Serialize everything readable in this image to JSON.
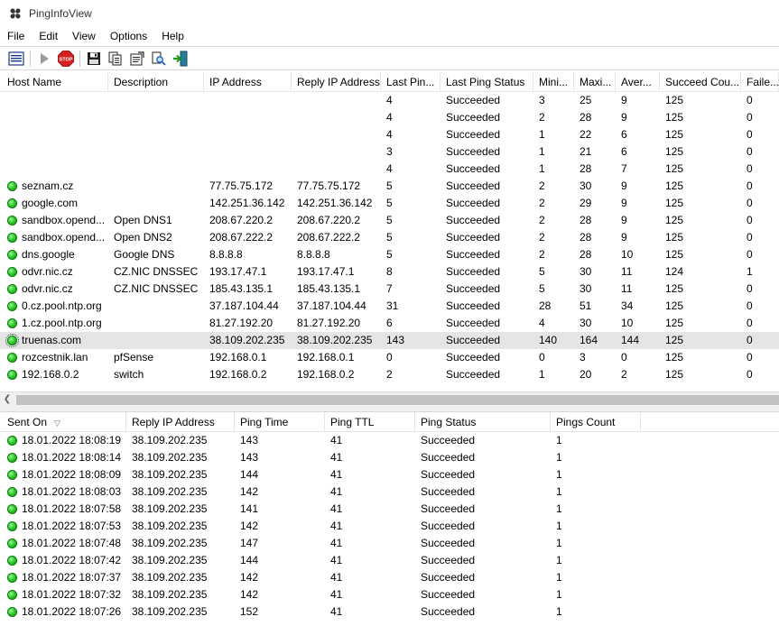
{
  "window": {
    "title": "PingInfoView",
    "icon": "ping-app-icon"
  },
  "menu": [
    "File",
    "Edit",
    "View",
    "Options",
    "Help"
  ],
  "toolbar": {
    "buttons": [
      {
        "name": "properties-list-button",
        "icon": "list-icon"
      },
      {
        "name": "start-ping-button",
        "icon": "play-icon"
      },
      {
        "name": "stop-ping-button",
        "icon": "stop-icon",
        "label": "STOP"
      },
      {
        "name": "save-button",
        "icon": "floppy-icon"
      },
      {
        "name": "copy-button",
        "icon": "copy-icon"
      },
      {
        "name": "properties-button",
        "icon": "properties-icon"
      },
      {
        "name": "find-button",
        "icon": "find-icon"
      },
      {
        "name": "exit-button",
        "icon": "exit-icon"
      }
    ]
  },
  "hosts": {
    "columns": [
      "Host Name",
      "Description",
      "IP Address",
      "Reply IP Address",
      "Last Pin...",
      "Last Ping Status",
      "Mini...",
      "Maxi...",
      "Aver...",
      "Succeed Cou...",
      "Faile..."
    ],
    "rows": [
      [
        "",
        "",
        "",
        "",
        "4",
        "Succeeded",
        "3",
        "25",
        "9",
        "125",
        "0"
      ],
      [
        "",
        "",
        "",
        "",
        "4",
        "Succeeded",
        "2",
        "28",
        "9",
        "125",
        "0"
      ],
      [
        "",
        "",
        "",
        "",
        "4",
        "Succeeded",
        "1",
        "22",
        "6",
        "125",
        "0"
      ],
      [
        "",
        "",
        "",
        "",
        "3",
        "Succeeded",
        "1",
        "21",
        "6",
        "125",
        "0"
      ],
      [
        "",
        "",
        "",
        "",
        "4",
        "Succeeded",
        "1",
        "28",
        "7",
        "125",
        "0"
      ],
      [
        "seznam.cz",
        "",
        "77.75.75.172",
        "77.75.75.172",
        "5",
        "Succeeded",
        "2",
        "30",
        "9",
        "125",
        "0"
      ],
      [
        "google.com",
        "",
        "142.251.36.142",
        "142.251.36.142",
        "5",
        "Succeeded",
        "2",
        "29",
        "9",
        "125",
        "0"
      ],
      [
        "sandbox.opend...",
        "Open DNS1",
        "208.67.220.2",
        "208.67.220.2",
        "5",
        "Succeeded",
        "2",
        "28",
        "9",
        "125",
        "0"
      ],
      [
        "sandbox.opend...",
        "Open DNS2",
        "208.67.222.2",
        "208.67.222.2",
        "5",
        "Succeeded",
        "2",
        "28",
        "9",
        "125",
        "0"
      ],
      [
        "dns.google",
        "Google DNS",
        "8.8.8.8",
        "8.8.8.8",
        "5",
        "Succeeded",
        "2",
        "28",
        "10",
        "125",
        "0"
      ],
      [
        "odvr.nic.cz",
        "CZ.NIC DNSSEC",
        "193.17.47.1",
        "193.17.47.1",
        "8",
        "Succeeded",
        "5",
        "30",
        "11",
        "124",
        "1"
      ],
      [
        "odvr.nic.cz",
        "CZ.NIC DNSSEC",
        "185.43.135.1",
        "185.43.135.1",
        "7",
        "Succeeded",
        "5",
        "30",
        "11",
        "125",
        "0"
      ],
      [
        "0.cz.pool.ntp.org",
        "",
        "37.187.104.44",
        "37.187.104.44",
        "31",
        "Succeeded",
        "28",
        "51",
        "34",
        "125",
        "0"
      ],
      [
        "1.cz.pool.ntp.org",
        "",
        "81.27.192.20",
        "81.27.192.20",
        "6",
        "Succeeded",
        "4",
        "30",
        "10",
        "125",
        "0"
      ],
      [
        "truenas.com",
        "",
        "38.109.202.235",
        "38.109.202.235",
        "143",
        "Succeeded",
        "140",
        "164",
        "144",
        "125",
        "0"
      ],
      [
        "rozcestnik.lan",
        "pfSense",
        "192.168.0.1",
        "192.168.0.1",
        "0",
        "Succeeded",
        "0",
        "3",
        "0",
        "125",
        "0"
      ],
      [
        "192.168.0.2",
        "switch",
        "192.168.0.2",
        "192.168.0.2",
        "2",
        "Succeeded",
        "1",
        "20",
        "2",
        "125",
        "0"
      ]
    ],
    "selected_index": 14
  },
  "history": {
    "columns": [
      "Sent On",
      "Reply IP Address",
      "Ping Time",
      "Ping TTL",
      "Ping Status",
      "Pings Count"
    ],
    "rows": [
      [
        "18.01.2022 18:08:19",
        "38.109.202.235",
        "143",
        "41",
        "Succeeded",
        "1"
      ],
      [
        "18.01.2022 18:08:14",
        "38.109.202.235",
        "143",
        "41",
        "Succeeded",
        "1"
      ],
      [
        "18.01.2022 18:08:09",
        "38.109.202.235",
        "144",
        "41",
        "Succeeded",
        "1"
      ],
      [
        "18.01.2022 18:08:03",
        "38.109.202.235",
        "142",
        "41",
        "Succeeded",
        "1"
      ],
      [
        "18.01.2022 18:07:58",
        "38.109.202.235",
        "141",
        "41",
        "Succeeded",
        "1"
      ],
      [
        "18.01.2022 18:07:53",
        "38.109.202.235",
        "142",
        "41",
        "Succeeded",
        "1"
      ],
      [
        "18.01.2022 18:07:48",
        "38.109.202.235",
        "147",
        "41",
        "Succeeded",
        "1"
      ],
      [
        "18.01.2022 18:07:42",
        "38.109.202.235",
        "144",
        "41",
        "Succeeded",
        "1"
      ],
      [
        "18.01.2022 18:07:37",
        "38.109.202.235",
        "142",
        "41",
        "Succeeded",
        "1"
      ],
      [
        "18.01.2022 18:07:32",
        "38.109.202.235",
        "142",
        "41",
        "Succeeded",
        "1"
      ],
      [
        "18.01.2022 18:07:26",
        "38.109.202.235",
        "152",
        "41",
        "Succeeded",
        "1"
      ]
    ]
  },
  "colors": {
    "status_ok": "#2fcf2f",
    "selection": "#e5e5e5",
    "stop": "#d42020"
  }
}
